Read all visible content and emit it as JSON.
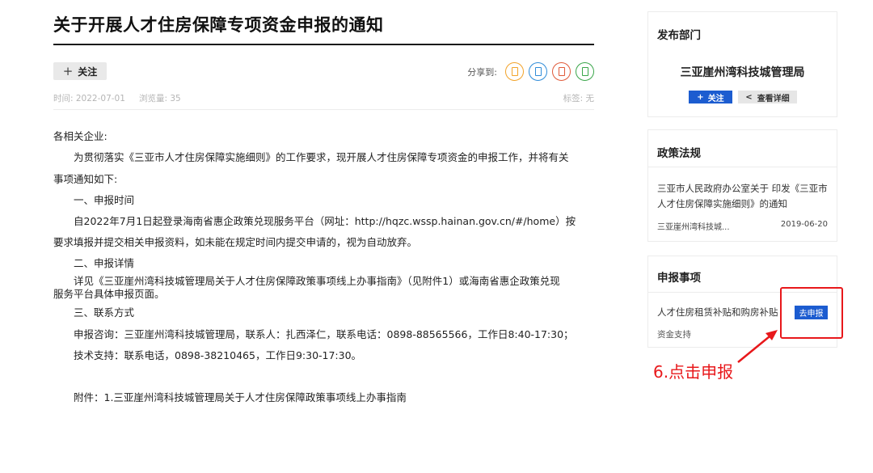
{
  "article": {
    "title": "关于开展人才住房保障专项资金申报的通知",
    "follow_label": "关注",
    "share_label": "分享到:",
    "share_icons": [
      {
        "name": "share-icon-1",
        "color": "#f2a32a"
      },
      {
        "name": "share-icon-2",
        "color": "#2f8cd8"
      },
      {
        "name": "share-icon-3",
        "color": "#e05a3a"
      },
      {
        "name": "share-icon-4",
        "color": "#3aa64a"
      }
    ],
    "date": "时间: 2022-07-01",
    "views": "浏览量: 35",
    "tags": "标签: 无",
    "paragraphs": [
      "各相关企业:",
      "为贯彻落实《三亚市人才住房保障实施细则》的工作要求，现开展人才住房保障专项资金的申报工作，并将有关",
      "事项通知如下:",
      "一、申报时间",
      "自2022年7月1日起登录海南省惠企政策兑现服务平台（网址：http://hqzc.wssp.hainan.gov.cn/#/home）按",
      "要求填报并提交相关申报资料，如未能在规定时间内提交申请的，视为自动放弃。",
      "二、申报详情",
      "详见《三亚崖州湾科技城管理局关于人才住房保障政策事项线上办事指南》（见附件1）或海南省惠企政策兑现",
      "服务平台具体申报页面。",
      "三、联系方式",
      "申报咨询：三亚崖州湾科技城管理局，联系人：扎西泽仁，联系电话：0898-88565566，工作日8:40-17:30；",
      "技术支持：联系电话，0898-38210465，工作日9:30-17:30。",
      "附件：1.三亚崖州湾科技城管理局关于人才住房保障政策事项线上办事指南"
    ]
  },
  "sidebar": {
    "dept": {
      "title": "发布部门",
      "name": "三亚崖州湾科技城管理局",
      "follow_label": "关注",
      "detail_label": "查看详细"
    },
    "policy": {
      "title": "政策法规",
      "link_line1": "三亚市人民政府办公室关于 印发《三亚市",
      "link_line2": "人才住房保障实施细则》的通知",
      "source": "三亚崖州湾科技城...",
      "date": "2019-06-20"
    },
    "apply": {
      "title": "申报事项",
      "item_title": "人才住房租赁补贴和购房补贴",
      "item_sub": "资金支持",
      "button_label": "去申报"
    }
  },
  "annotation": {
    "text": "6.点击申报",
    "color": "#e8181b"
  }
}
